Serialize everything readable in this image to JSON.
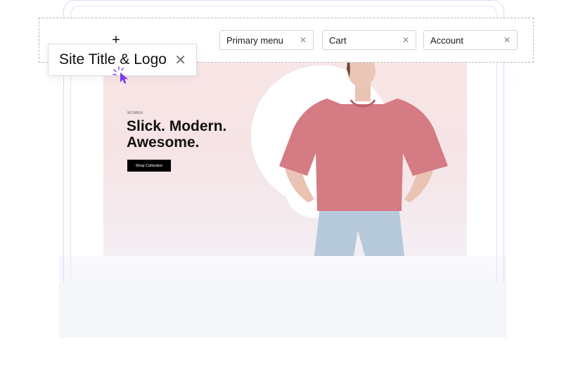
{
  "header": {
    "add_icon": "plus-icon",
    "chips": [
      {
        "label": "Primary menu",
        "close_icon": "close-icon"
      },
      {
        "label": "Cart",
        "close_icon": "close-icon"
      },
      {
        "label": "Account",
        "close_icon": "close-icon"
      }
    ]
  },
  "dragging_chip": {
    "label": "Site Title & Logo",
    "close_icon": "close-icon"
  },
  "hero": {
    "eyebrow": "WOMEN",
    "title": "Slick. Modern. Awesome.",
    "button_label": "Shop Collection"
  },
  "colors": {
    "accent": "#7c3aed",
    "hero_bg": "#f8e6e7",
    "shirt": "#d47b84",
    "jeans": "#b7cadb"
  },
  "cursor": "pointer-click-icon"
}
